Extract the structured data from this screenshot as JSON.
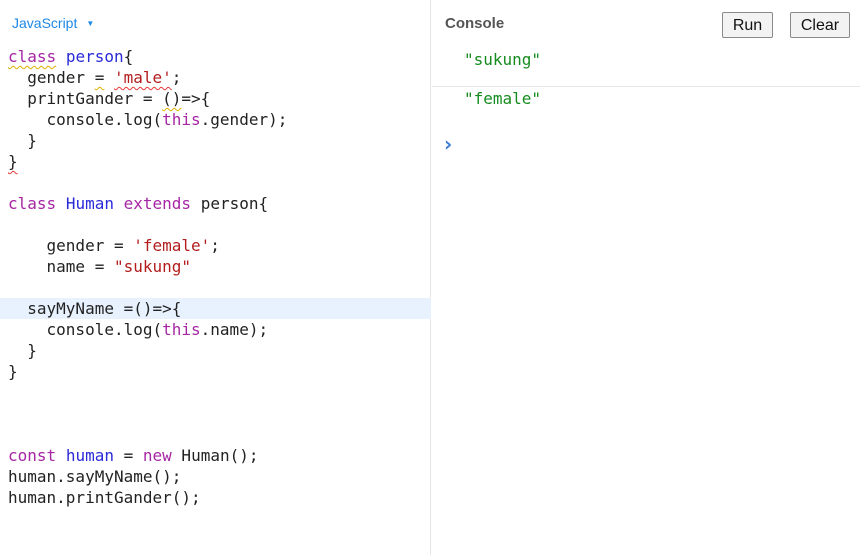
{
  "editor": {
    "language_label": "JavaScript",
    "language_caret": "▼",
    "lines": [
      [
        {
          "t": "kw",
          "v": "class",
          "sq": "yellow"
        },
        {
          "t": "plain",
          "v": " "
        },
        {
          "t": "cls",
          "v": "person"
        },
        {
          "t": "plain",
          "v": "{"
        }
      ],
      [
        {
          "t": "plain",
          "v": "  gender "
        },
        {
          "t": "plain",
          "v": "=",
          "sq": "yellow"
        },
        {
          "t": "plain",
          "v": " "
        },
        {
          "t": "str",
          "v": "'male'",
          "sq": "red"
        },
        {
          "t": "plain",
          "v": ";"
        }
      ],
      [
        {
          "t": "plain",
          "v": "  printGander = "
        },
        {
          "t": "plain",
          "v": "()",
          "sq": "yellow"
        },
        {
          "t": "plain",
          "v": "=>{"
        }
      ],
      [
        {
          "t": "plain",
          "v": "    console.log("
        },
        {
          "t": "kw",
          "v": "this"
        },
        {
          "t": "plain",
          "v": ".gender);"
        }
      ],
      [
        {
          "t": "plain",
          "v": "  }"
        }
      ],
      [
        {
          "t": "plain",
          "v": "}",
          "sq": "red"
        }
      ],
      [],
      [
        {
          "t": "kw",
          "v": "class"
        },
        {
          "t": "plain",
          "v": " "
        },
        {
          "t": "cls",
          "v": "Human"
        },
        {
          "t": "plain",
          "v": " "
        },
        {
          "t": "kw",
          "v": "extends"
        },
        {
          "t": "plain",
          "v": " person{"
        }
      ],
      [],
      [
        {
          "t": "plain",
          "v": "    gender = "
        },
        {
          "t": "str",
          "v": "'female'"
        },
        {
          "t": "plain",
          "v": ";"
        }
      ],
      [
        {
          "t": "plain",
          "v": "    name = "
        },
        {
          "t": "str",
          "v": "\"sukung\""
        }
      ],
      [],
      [
        {
          "t": "plain",
          "v": "  sayMyName =()=>{"
        }
      ],
      [
        {
          "t": "plain",
          "v": "    console.log("
        },
        {
          "t": "kw",
          "v": "this"
        },
        {
          "t": "plain",
          "v": ".name);"
        }
      ],
      [
        {
          "t": "plain",
          "v": "  }"
        }
      ],
      [
        {
          "t": "plain",
          "v": "}"
        }
      ],
      [],
      [],
      [],
      [
        {
          "t": "kw",
          "v": "const"
        },
        {
          "t": "plain",
          "v": " "
        },
        {
          "t": "cls",
          "v": "human"
        },
        {
          "t": "plain",
          "v": " = "
        },
        {
          "t": "kw",
          "v": "new"
        },
        {
          "t": "plain",
          "v": " Human();"
        }
      ],
      [
        {
          "t": "plain",
          "v": "human.sayMyName();"
        }
      ],
      [
        {
          "t": "plain",
          "v": "human.printGander();"
        }
      ]
    ],
    "highlighted_line": 12
  },
  "console": {
    "title": "Console",
    "run_label": "Run",
    "clear_label": "Clear",
    "entries": [
      "\"sukung\"",
      "\"female\""
    ],
    "prompt_glyph": "›"
  },
  "colors": {
    "keyword": "#a626a4",
    "class_name": "#2a2ad8",
    "string": "#b31d1d",
    "console_output": "#168c1e",
    "language_link": "#1e88e5",
    "prompt": "#3a7bd5"
  }
}
